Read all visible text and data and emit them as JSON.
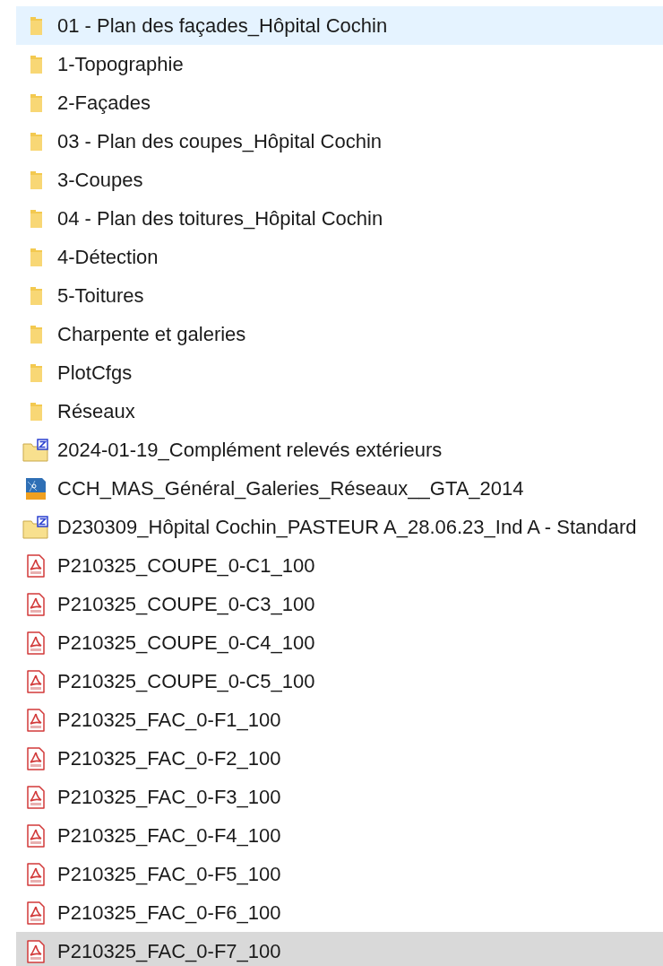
{
  "files": [
    {
      "name": "01 - Plan des façades_Hôpital Cochin",
      "kind": "folder",
      "hovered": true,
      "selected": false
    },
    {
      "name": "1-Topographie",
      "kind": "folder",
      "hovered": false,
      "selected": false
    },
    {
      "name": "2-Façades",
      "kind": "folder",
      "hovered": false,
      "selected": false
    },
    {
      "name": "03 - Plan des coupes_Hôpital Cochin",
      "kind": "folder",
      "hovered": false,
      "selected": false
    },
    {
      "name": "3-Coupes",
      "kind": "folder",
      "hovered": false,
      "selected": false
    },
    {
      "name": "04 - Plan des toitures_Hôpital Cochin",
      "kind": "folder",
      "hovered": false,
      "selected": false
    },
    {
      "name": "4-Détection",
      "kind": "folder",
      "hovered": false,
      "selected": false
    },
    {
      "name": "5-Toitures",
      "kind": "folder",
      "hovered": false,
      "selected": false
    },
    {
      "name": "Charpente et galeries",
      "kind": "folder",
      "hovered": false,
      "selected": false
    },
    {
      "name": "PlotCfgs",
      "kind": "folder",
      "hovered": false,
      "selected": false
    },
    {
      "name": "Réseaux",
      "kind": "folder",
      "hovered": false,
      "selected": false
    },
    {
      "name": "2024-01-19_Complément relevés extérieurs",
      "kind": "zip",
      "hovered": false,
      "selected": false
    },
    {
      "name": "CCH_MAS_Général_Galeries_Réseaux__GTA_2014",
      "kind": "dwg",
      "hovered": false,
      "selected": false
    },
    {
      "name": "D230309_Hôpital Cochin_PASTEUR A_28.06.23_Ind A - Standard",
      "kind": "zip",
      "hovered": false,
      "selected": false
    },
    {
      "name": "P210325_COUPE_0-C1_100",
      "kind": "pdf",
      "hovered": false,
      "selected": false
    },
    {
      "name": "P210325_COUPE_0-C3_100",
      "kind": "pdf",
      "hovered": false,
      "selected": false
    },
    {
      "name": "P210325_COUPE_0-C4_100",
      "kind": "pdf",
      "hovered": false,
      "selected": false
    },
    {
      "name": "P210325_COUPE_0-C5_100",
      "kind": "pdf",
      "hovered": false,
      "selected": false
    },
    {
      "name": "P210325_FAC_0-F1_100",
      "kind": "pdf",
      "hovered": false,
      "selected": false
    },
    {
      "name": "P210325_FAC_0-F2_100",
      "kind": "pdf",
      "hovered": false,
      "selected": false
    },
    {
      "name": "P210325_FAC_0-F3_100",
      "kind": "pdf",
      "hovered": false,
      "selected": false
    },
    {
      "name": "P210325_FAC_0-F4_100",
      "kind": "pdf",
      "hovered": false,
      "selected": false
    },
    {
      "name": "P210325_FAC_0-F5_100",
      "kind": "pdf",
      "hovered": false,
      "selected": false
    },
    {
      "name": "P210325_FAC_0-F6_100",
      "kind": "pdf",
      "hovered": false,
      "selected": false
    },
    {
      "name": "P210325_FAC_0-F7_100",
      "kind": "pdf",
      "hovered": false,
      "selected": true
    }
  ]
}
